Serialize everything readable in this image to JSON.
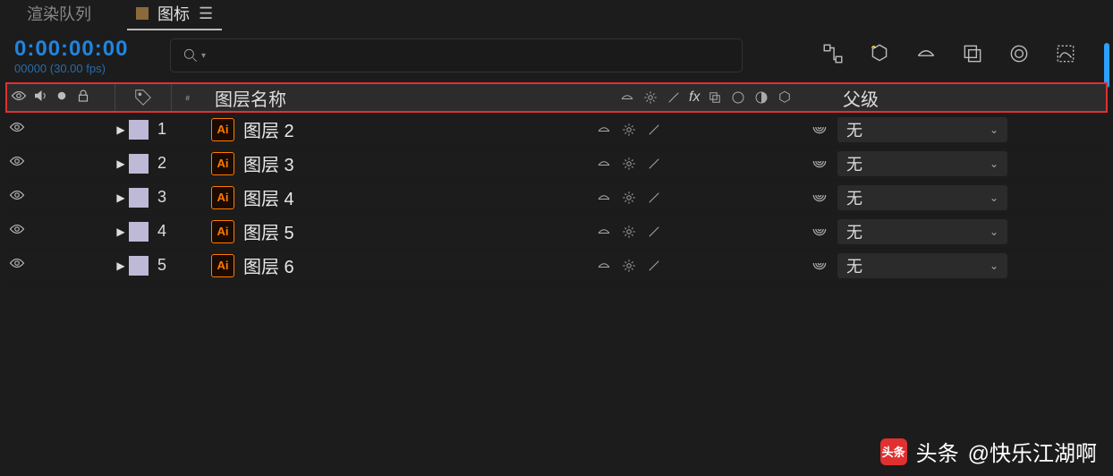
{
  "tabs": {
    "render_queue": "渲染队列",
    "comp": "图标"
  },
  "timecode": "0:00:00:00",
  "timeinfo": "00000 (30.00 fps)",
  "columns": {
    "layer_name": "图层名称",
    "parent": "父级"
  },
  "ai_label": "Ai",
  "parent_none": "无",
  "layers": [
    {
      "index": "1",
      "name": "图层 2"
    },
    {
      "index": "2",
      "name": "图层 3"
    },
    {
      "index": "3",
      "name": "图层 4"
    },
    {
      "index": "4",
      "name": "图层 5"
    },
    {
      "index": "5",
      "name": "图层 6"
    }
  ],
  "watermark": {
    "prefix": "头条",
    "author": "@快乐江湖啊"
  }
}
